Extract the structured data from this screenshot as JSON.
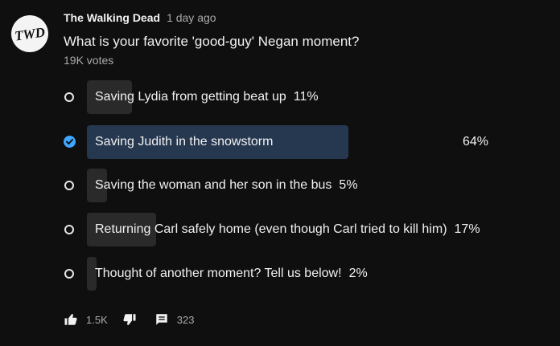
{
  "channel": {
    "logo_text": "TWD",
    "name": "The Walking Dead",
    "timestamp": "1 day ago"
  },
  "poll": {
    "question": "What is your favorite 'good-guy' Negan moment?",
    "votes": "19K votes",
    "options": [
      {
        "label": "Saving Lydia from getting beat up",
        "percent_text": "11%",
        "percent": 11,
        "selected": false
      },
      {
        "label": "Saving Judith in the snowstorm",
        "percent_text": "64%",
        "percent": 64,
        "selected": true
      },
      {
        "label": "Saving the woman and her son in the bus",
        "percent_text": "5%",
        "percent": 5,
        "selected": false
      },
      {
        "label": "Returning Carl safely home (even though Carl tried to kill him)",
        "percent_text": "17%",
        "percent": 17,
        "selected": false
      },
      {
        "label": "Thought of another moment? Tell us below!",
        "percent_text": "2%",
        "percent": 2,
        "selected": false
      }
    ]
  },
  "actions": {
    "like_count": "1.5K",
    "comment_count": "323"
  },
  "colors": {
    "background": "#0f0f0f",
    "bar": "#2a2a2a",
    "selected_bar": "#263850",
    "accent": "#3ea6ff",
    "secondary_text": "#aaaaaa"
  },
  "icons": [
    "twd-logo",
    "radio-icon",
    "check-icon",
    "like-icon",
    "dislike-icon",
    "comment-icon"
  ]
}
